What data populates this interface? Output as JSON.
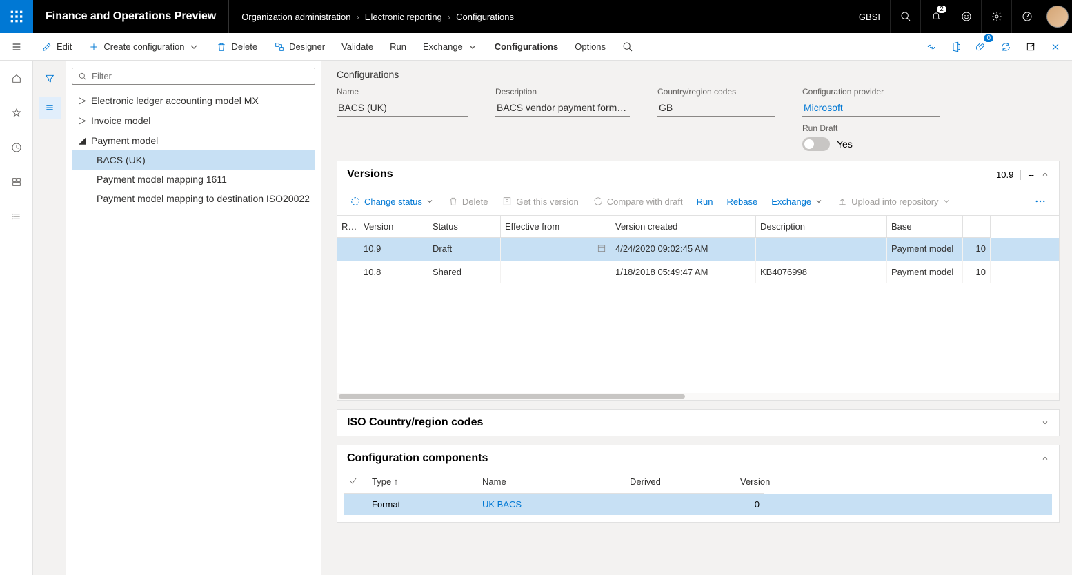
{
  "app": {
    "title": "Finance and Operations Preview"
  },
  "breadcrumb": [
    "Organization administration",
    "Electronic reporting",
    "Configurations"
  ],
  "org": "GBSI",
  "notifications_count": "2",
  "actions": {
    "edit": "Edit",
    "create": "Create configuration",
    "delete": "Delete",
    "designer": "Designer",
    "validate": "Validate",
    "run": "Run",
    "exchange": "Exchange",
    "configurations": "Configurations",
    "options": "Options"
  },
  "attach_count": "0",
  "filter_placeholder": "Filter",
  "tree": [
    {
      "label": "Electronic ledger accounting model MX",
      "level": 1,
      "expanded": false
    },
    {
      "label": "Invoice model",
      "level": 1,
      "expanded": false
    },
    {
      "label": "Payment model",
      "level": 1,
      "expanded": true
    },
    {
      "label": "BACS (UK)",
      "level": 2,
      "selected": true
    },
    {
      "label": "Payment model mapping 1611",
      "level": 2
    },
    {
      "label": "Payment model mapping to destination ISO20022",
      "level": 2
    }
  ],
  "details": {
    "heading": "Configurations",
    "name_label": "Name",
    "name": "BACS (UK)",
    "desc_label": "Description",
    "desc": "BACS vendor payment format f...",
    "country_label": "Country/region codes",
    "country": "GB",
    "provider_label": "Configuration provider",
    "provider": "Microsoft",
    "rundraft_label": "Run Draft",
    "rundraft_value": "Yes"
  },
  "versions": {
    "title": "Versions",
    "badge": "10.9",
    "dashes": "--",
    "toolbar": {
      "change_status": "Change status",
      "delete": "Delete",
      "get": "Get this version",
      "compare": "Compare with draft",
      "run": "Run",
      "rebase": "Rebase",
      "exchange": "Exchange",
      "upload": "Upload into repository"
    },
    "columns": [
      "R...",
      "Version",
      "Status",
      "Effective from",
      "Version created",
      "Description",
      "Base",
      ""
    ],
    "rows": [
      {
        "version": "10.9",
        "status": "Draft",
        "effective": "",
        "created": "4/24/2020 09:02:45 AM",
        "desc": "",
        "base": "Payment model",
        "basen": "10",
        "selected": true,
        "linkbase": true
      },
      {
        "version": "10.8",
        "status": "Shared",
        "effective": "",
        "created": "1/18/2018 05:49:47 AM",
        "desc": "KB4076998",
        "base": "Payment model",
        "basen": "10"
      }
    ]
  },
  "iso": {
    "title": "ISO Country/region codes"
  },
  "components": {
    "title": "Configuration components",
    "columns": [
      "",
      "Type ↑",
      "Name",
      "Derived",
      "Version"
    ],
    "rows": [
      {
        "type": "Format",
        "name": "UK BACS",
        "derived": "",
        "version": "0",
        "selected": true
      }
    ]
  }
}
